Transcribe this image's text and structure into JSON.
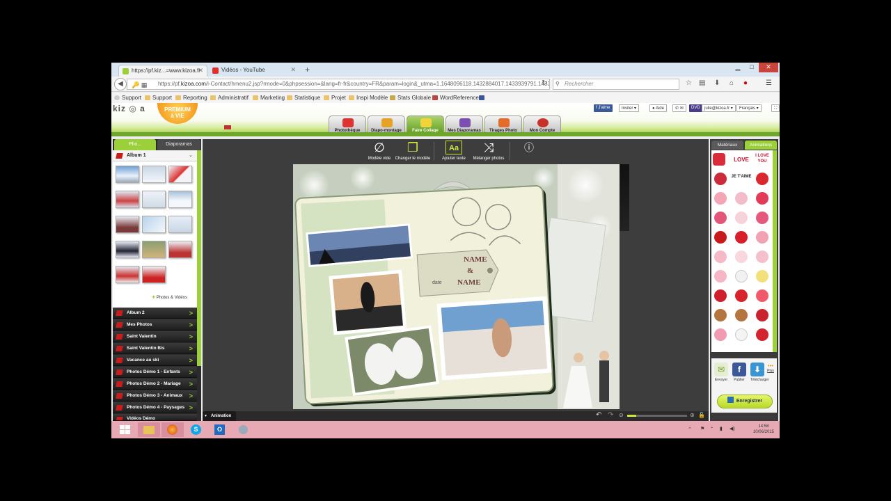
{
  "browser": {
    "tabs": [
      {
        "label": "https://pf.kiz...=www.kizoa.fr",
        "active": true
      },
      {
        "label": "Vidéos - YouTube",
        "active": false
      }
    ],
    "url_prefix": "https://pf.",
    "url_host": "kizoa.com",
    "url_rest": "/i-Contact/hmenu2.jsp?rmode=0&phpsession=&lang=fr-fr&country=FR&param=login&_utma=1.1648096118.1432884017.1433939791.1433",
    "search_placeholder": "Rechercher",
    "bookmarks": [
      "Support",
      "Support",
      "Reporting",
      "Administratif",
      "Marketing",
      "Statistique",
      "Projet",
      "Inspi Modèle",
      "Stats Globale",
      "WordReference"
    ]
  },
  "kizoa": {
    "logo": "kiz ◎ a",
    "premium_line1": "PREMIUM",
    "premium_line2": "à VIE",
    "nav_tabs": [
      "Photothèque",
      "Diapo-montage",
      "Faire Collage",
      "Mes Diaporamas",
      "Tirages Photo",
      "Mon Compte"
    ],
    "active_tab": "Faire Collage",
    "social": {
      "like": "J'aime",
      "invite": "Inviter",
      "help": "Aide",
      "dvd": "DVD",
      "user": "julie@kizoa.fr",
      "lang": "Français"
    }
  },
  "sidebar": {
    "tab_photos": "Pho...",
    "tab_slideshows": "Diaporamas",
    "album_open": "Album 1",
    "photos_videos": "Photos & Vidéos",
    "albums": [
      "Album 2",
      "Mes Photos",
      "Saint Valentin",
      "Saint Valentin Bis",
      "Vacance au ski",
      "Photos Démo 1 - Enfants",
      "Photos Démo 2 - Mariage",
      "Photos Démo 3 - Animaux",
      "Photos Démo 4 - Paysages",
      "Vidéos Démo"
    ]
  },
  "toolbar": {
    "empty_model": "Modèle vide",
    "change_model": "Changer le modèle",
    "add_text": "Ajouter texte",
    "shuffle": "Mélanger photos"
  },
  "collage": {
    "name1": "NAME",
    "amp": "&",
    "name2": "NAME",
    "date": "date"
  },
  "right_panel": {
    "tab_materials": "Matériaux",
    "tab_animations": "Animations",
    "sticker_love": "LOVE",
    "sticker_iloveyou": "I LOVE YOU",
    "sticker_taime": "JE T'AIME",
    "actions": [
      "Envoyer",
      "Publier",
      "Télécharger"
    ],
    "more": "Plus",
    "save": "Enregistrer"
  },
  "bottom": {
    "animation_tab": "Animation",
    "zoom_level": 0.15
  },
  "taskbar": {
    "time": "14:58",
    "date": "10/06/2015"
  }
}
